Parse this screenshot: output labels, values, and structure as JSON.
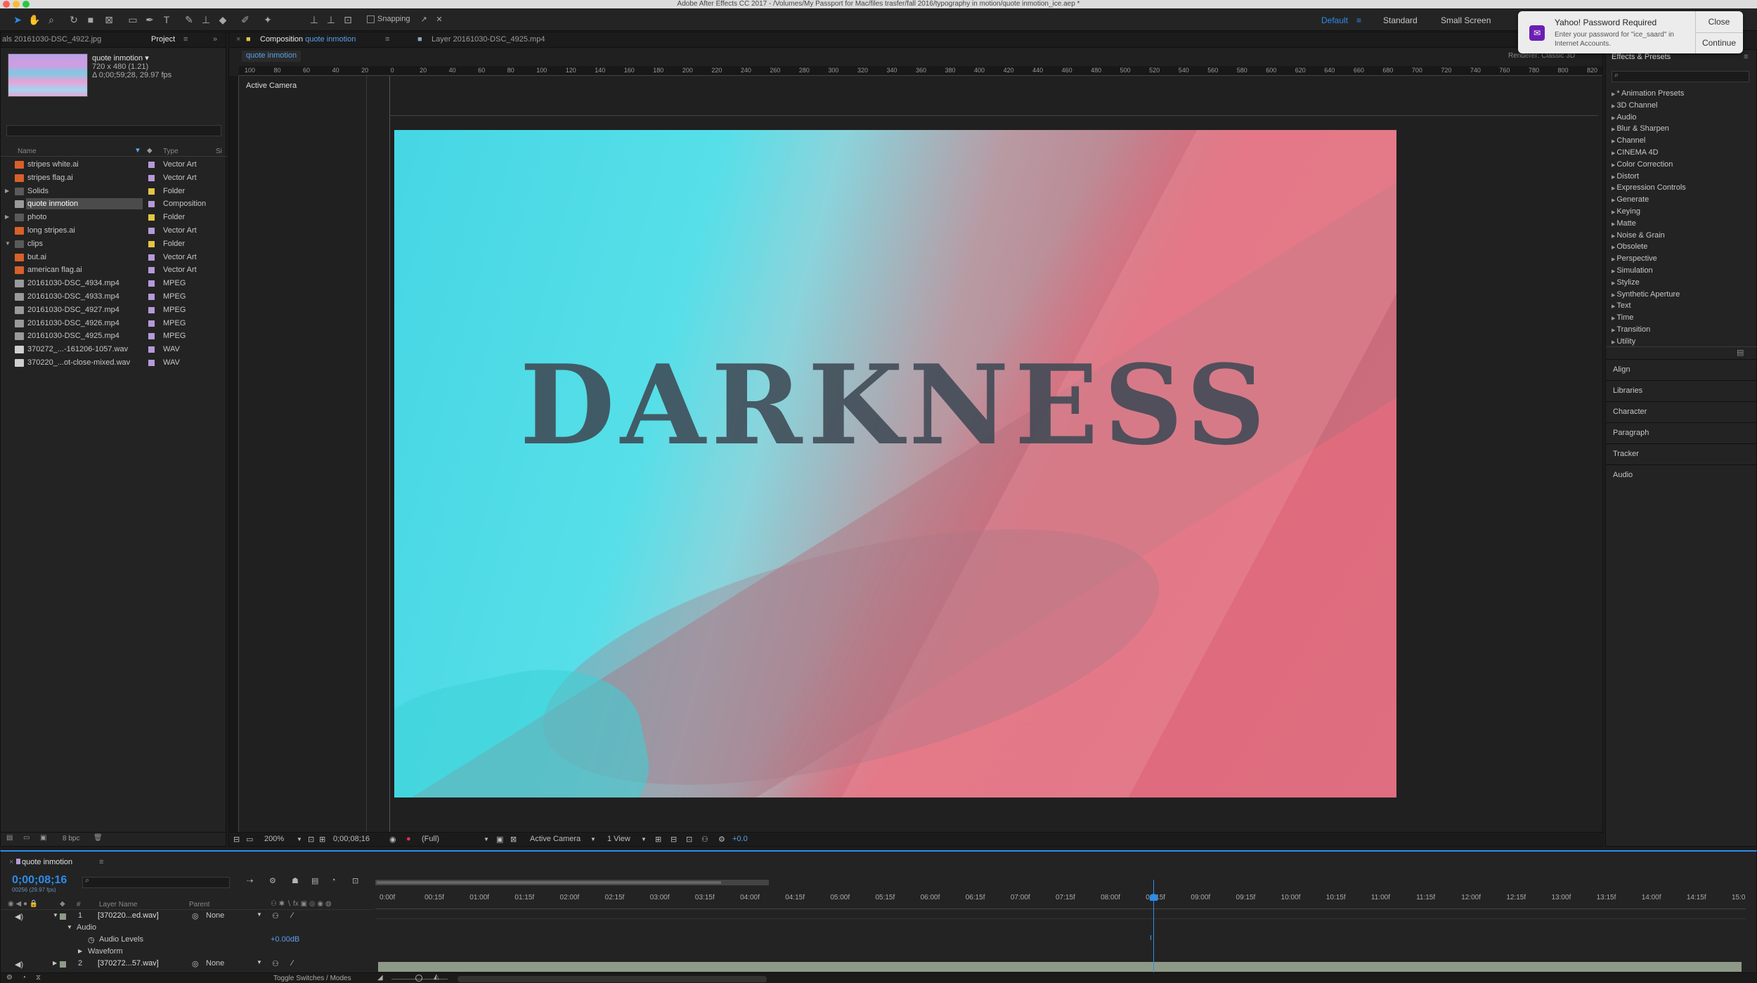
{
  "window": {
    "title": "Adobe After Effects CC 2017 - /Volumes/My Passport for Mac/files trasfer/fall 2016/typography in motion/quote inmotion_ice.aep *"
  },
  "toolbar": {
    "snapping_label": "Snapping",
    "workspaces": [
      "Default",
      "Standard",
      "Small Screen"
    ]
  },
  "notification": {
    "title": "Yahoo! Password Required",
    "body": "Enter your password for \"ice_saard\" in Internet Accounts.",
    "close_label": "Close",
    "continue_label": "Continue"
  },
  "project": {
    "left_tab": "als 20161030-DSC_4922.jpg",
    "tab": "Project",
    "comp_name": "quote inmotion ▾",
    "comp_size": "720 x 480 (1.21)",
    "comp_duration": "Δ 0;00;59;28, 29.97 fps",
    "col_name": "Name",
    "col_type": "Type",
    "col_size": "Si",
    "items": [
      {
        "name": "stripes white.ai",
        "type": "Vector Art",
        "kind": "ai",
        "color": "#b59ad8"
      },
      {
        "name": "stripes flag.ai",
        "type": "Vector Art",
        "kind": "ai",
        "color": "#b59ad8"
      },
      {
        "name": "Solids",
        "type": "Folder",
        "kind": "folder",
        "color": "#e3c544",
        "twirl": "▶"
      },
      {
        "name": "quote inmotion",
        "type": "Composition",
        "kind": "comp",
        "color": "#b59ad8",
        "selected": true
      },
      {
        "name": "photo",
        "type": "Folder",
        "kind": "folder",
        "color": "#e3c544",
        "twirl": "▶"
      },
      {
        "name": "long stripes.ai",
        "type": "Vector Art",
        "kind": "ai",
        "color": "#b59ad8"
      },
      {
        "name": "clips",
        "type": "Folder",
        "kind": "folder",
        "color": "#e3c544",
        "twirl": "▼"
      },
      {
        "name": "but.ai",
        "type": "Vector Art",
        "kind": "ai",
        "color": "#b59ad8"
      },
      {
        "name": "american flag.ai",
        "type": "Vector Art",
        "kind": "ai",
        "color": "#b59ad8"
      },
      {
        "name": "20161030-DSC_4934.mp4",
        "type": "MPEG",
        "kind": "video",
        "color": "#b59ad8"
      },
      {
        "name": "20161030-DSC_4933.mp4",
        "type": "MPEG",
        "kind": "video",
        "color": "#b59ad8"
      },
      {
        "name": "20161030-DSC_4927.mp4",
        "type": "MPEG",
        "kind": "video",
        "color": "#b59ad8"
      },
      {
        "name": "20161030-DSC_4926.mp4",
        "type": "MPEG",
        "kind": "video",
        "color": "#b59ad8"
      },
      {
        "name": "20161030-DSC_4925.mp4",
        "type": "MPEG",
        "kind": "video",
        "color": "#b59ad8"
      },
      {
        "name": "370272_...-161206-1057.wav",
        "type": "WAV",
        "kind": "audio",
        "color": "#b59ad8"
      },
      {
        "name": "370220_...ot-close-mixed.wav",
        "type": "WAV",
        "kind": "audio",
        "color": "#b59ad8"
      }
    ],
    "bpc": "8 bpc"
  },
  "viewer": {
    "tab_prefix": "Composition",
    "tab_comp": "quote inmotion",
    "tab_layer": "Layer 20161030-DSC_4925.mp4",
    "breadcrumb": "quote inmotion",
    "renderer": "Renderer:  Classic 3D",
    "active_camera": "Active Camera",
    "title_text": "DARKNESS",
    "zoom": "200%",
    "timecode": "0;00;08;16",
    "resolution": "(Full)",
    "camera_select": "Active Camera",
    "views": "1 View",
    "exposure": "+0.0",
    "ruler_ticks": [
      "100",
      "80",
      "60",
      "40",
      "20",
      "0",
      "20",
      "40",
      "60",
      "80",
      "100",
      "120",
      "140",
      "160",
      "180",
      "200",
      "220",
      "240",
      "260",
      "280",
      "300",
      "320",
      "340",
      "360",
      "380",
      "400",
      "420",
      "440",
      "460",
      "480",
      "500",
      "520",
      "540",
      "560",
      "580",
      "600",
      "620",
      "640",
      "660",
      "680",
      "700",
      "720",
      "740",
      "760",
      "780",
      "800",
      "820"
    ]
  },
  "effects": {
    "title": "Effects & Presets",
    "items": [
      "* Animation Presets",
      "3D Channel",
      "Audio",
      "Blur & Sharpen",
      "Channel",
      "CINEMA 4D",
      "Color Correction",
      "Distort",
      "Expression Controls",
      "Generate",
      "Keying",
      "Matte",
      "Noise & Grain",
      "Obsolete",
      "Perspective",
      "Simulation",
      "Stylize",
      "Synthetic Aperture",
      "Text",
      "Time",
      "Transition",
      "Utility"
    ],
    "panels": [
      "Align",
      "Libraries",
      "Character",
      "Paragraph",
      "Tracker",
      "Audio"
    ]
  },
  "timeline": {
    "tab": "quote inmotion",
    "time": "0;00;08;16",
    "fps": "00256 (29.97 fps)",
    "col_layer": "Layer Name",
    "col_parent": "Parent",
    "layers": [
      {
        "num": "1",
        "name": "[370220...ed.wav]",
        "parent": "None"
      },
      {
        "num": "2",
        "name": "[370272...57.wav]",
        "parent": "None"
      }
    ],
    "audio_label": "Audio",
    "audio_levels_label": "Audio Levels",
    "audio_levels_value": "+0.00dB",
    "waveform_label": "Waveform",
    "toggle_label": "Toggle Switches / Modes",
    "ruler": [
      "0:00f",
      "00:15f",
      "01:00f",
      "01:15f",
      "02:00f",
      "02:15f",
      "03:00f",
      "03:15f",
      "04:00f",
      "04:15f",
      "05:00f",
      "05:15f",
      "06:00f",
      "06:15f",
      "07:00f",
      "07:15f",
      "08:00f",
      "08:15f",
      "09:00f",
      "09:15f",
      "10:00f",
      "10:15f",
      "11:00f",
      "11:15f",
      "12:00f",
      "12:15f",
      "13:00f",
      "13:15f",
      "14:00f",
      "14:15f",
      "15:0"
    ]
  }
}
